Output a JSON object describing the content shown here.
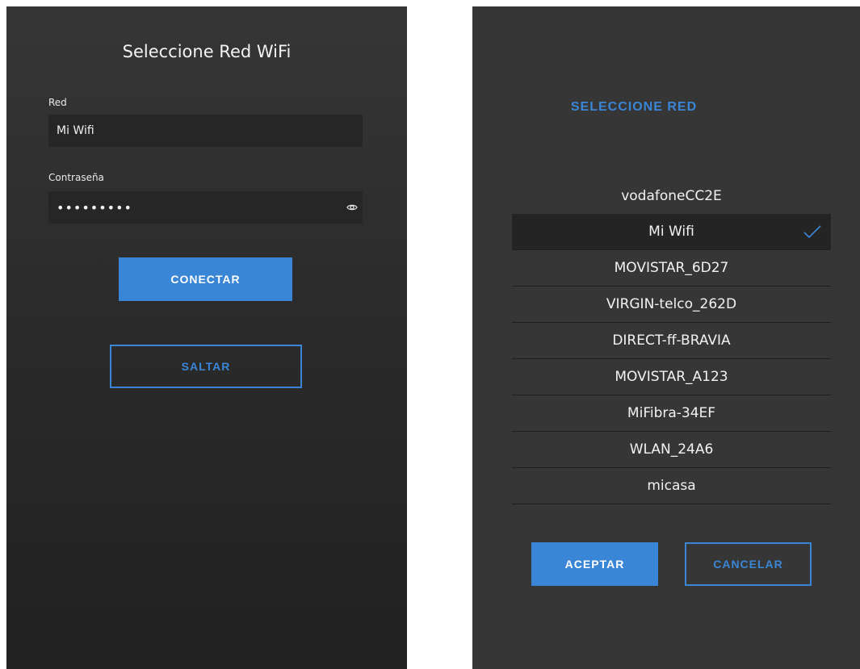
{
  "login": {
    "title": "Seleccione Red WiFi",
    "network_label": "Red",
    "network_value": "Mi Wifi",
    "password_label": "Contraseña",
    "password_value": "•••••••••",
    "connect_label": "CONECTAR",
    "skip_label": "SALTAR"
  },
  "dialog": {
    "title": "SELECCIONE RED",
    "networks": [
      {
        "name": "vodafoneCC2E",
        "selected": false
      },
      {
        "name": "Mi Wifi",
        "selected": true
      },
      {
        "name": "MOVISTAR_6D27",
        "selected": false
      },
      {
        "name": "VIRGIN-telco_262D",
        "selected": false
      },
      {
        "name": "DIRECT-ff-BRAVIA",
        "selected": false
      },
      {
        "name": "MOVISTAR_A123",
        "selected": false
      },
      {
        "name": "MiFibra-34EF",
        "selected": false
      },
      {
        "name": "WLAN_24A6",
        "selected": false
      },
      {
        "name": "micasa",
        "selected": false
      }
    ],
    "accept_label": "ACEPTAR",
    "cancel_label": "CANCELAR"
  },
  "icons": {
    "password_toggle": "eye-icon",
    "selected_marker": "checkmark-icon"
  },
  "colors": {
    "accent": "#3a86d6",
    "panel_bg": "#363636",
    "selected_bg": "#242424"
  }
}
